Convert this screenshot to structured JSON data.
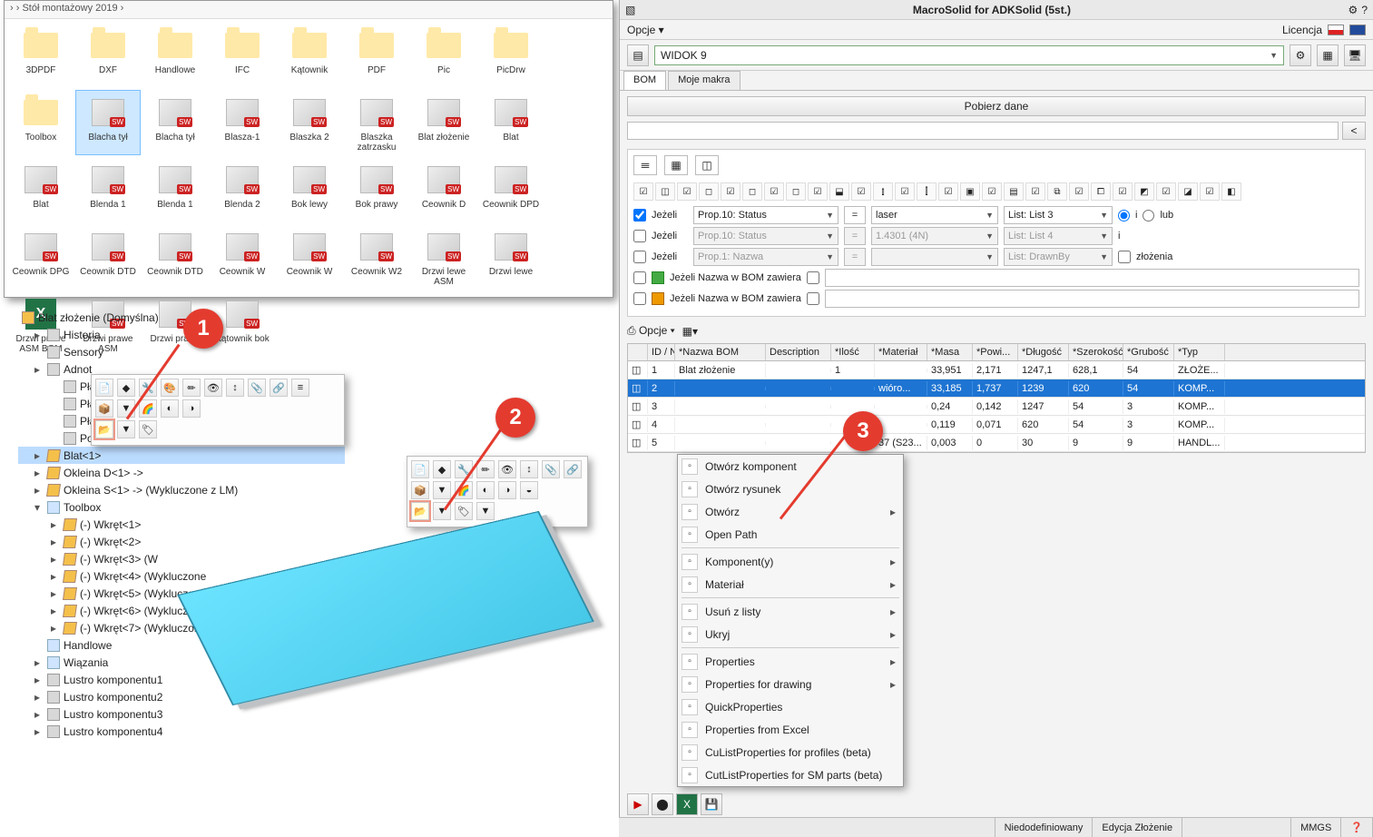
{
  "explorer": {
    "breadcrumb": "›  ›  Stół montażowy 2019  ›",
    "folders": [
      "3DPDF",
      "DXF",
      "Handlowe",
      "IFC",
      "Kątownik",
      "PDF",
      "Pic",
      "PicDrw",
      "Toolbox"
    ],
    "parts_r2": [
      "Blacha tył",
      "Blacha tył",
      "Blasza-1",
      "Blaszka 2",
      "Blaszka zatrzasku",
      "Blat złożenie",
      "Blat",
      "Blat",
      "Blenda 1"
    ],
    "parts_r3": [
      "Blenda 1",
      "Blenda 2",
      "Bok lewy",
      "Bok prawy",
      "Ceownik D",
      "Ceownik DPD",
      "Ceownik DPG",
      "Ceownik DTD",
      "Ceownik DTD"
    ],
    "parts_r4": [
      "Ceownik W",
      "Ceownik W",
      "Ceownik W2",
      "Drzwi lewe ASM",
      "Drzwi lewe",
      "Drzwi prawe ASM BOM",
      "Drzwi prawe ASM",
      "Drzwi prawe",
      "Kątownik bok"
    ],
    "selected": "Blacha tył"
  },
  "tree": {
    "root": "Blat złożenie  (Domyślna)",
    "items": [
      {
        "lvl": 1,
        "tri": "▸",
        "ico": "feat",
        "label": "Historia"
      },
      {
        "lvl": 1,
        "tri": "",
        "ico": "feat",
        "label": "Sensory"
      },
      {
        "lvl": 1,
        "tri": "▸",
        "ico": "feat",
        "label": "Adnot"
      },
      {
        "lvl": 2,
        "tri": "",
        "ico": "feat",
        "label": "Płaszc"
      },
      {
        "lvl": 2,
        "tri": "",
        "ico": "feat",
        "label": "Płaszc"
      },
      {
        "lvl": 2,
        "tri": "",
        "ico": "feat",
        "label": "Płaszc"
      },
      {
        "lvl": 2,
        "tri": "",
        "ico": "feat",
        "label": "Począ"
      },
      {
        "lvl": 1,
        "tri": "▸",
        "ico": "part",
        "label": "Blat<1>",
        "sel": true
      },
      {
        "lvl": 1,
        "tri": "▸",
        "ico": "part",
        "label": "Okleina D<1> ->"
      },
      {
        "lvl": 1,
        "tri": "▸",
        "ico": "part",
        "label": "Okleina S<1> -> (Wykluczone z LM)"
      },
      {
        "lvl": 1,
        "tri": "▾",
        "ico": "folder",
        "label": "Toolbox"
      },
      {
        "lvl": 2,
        "tri": "▸",
        "ico": "part",
        "label": "(-) Wkręt<1>"
      },
      {
        "lvl": 2,
        "tri": "▸",
        "ico": "part",
        "label": "(-) Wkręt<2>"
      },
      {
        "lvl": 2,
        "tri": "▸",
        "ico": "part",
        "label": "(-) Wkręt<3> (W"
      },
      {
        "lvl": 2,
        "tri": "▸",
        "ico": "part",
        "label": "(-) Wkręt<4> (Wykluczone"
      },
      {
        "lvl": 2,
        "tri": "▸",
        "ico": "part",
        "label": "(-) Wkręt<5> (Wykluczone z LM"
      },
      {
        "lvl": 2,
        "tri": "▸",
        "ico": "part",
        "label": "(-) Wkręt<6> (Wykluczone z LM)"
      },
      {
        "lvl": 2,
        "tri": "▸",
        "ico": "part",
        "label": "(-) Wkręt<7> (Wykluczone z LM)"
      },
      {
        "lvl": 1,
        "tri": "",
        "ico": "folder",
        "label": "Handlowe"
      },
      {
        "lvl": 1,
        "tri": "▸",
        "ico": "folder",
        "label": "Wiązania"
      },
      {
        "lvl": 1,
        "tri": "▸",
        "ico": "feat",
        "label": "Lustro komponentu1"
      },
      {
        "lvl": 1,
        "tri": "▸",
        "ico": "feat",
        "label": "Lustro komponentu2"
      },
      {
        "lvl": 1,
        "tri": "▸",
        "ico": "feat",
        "label": "Lustro komponentu3"
      },
      {
        "lvl": 1,
        "tri": "▸",
        "ico": "feat",
        "label": "Lustro komponentu4"
      }
    ]
  },
  "badges": {
    "b1": "1",
    "b2": "2",
    "b3": "3"
  },
  "macrosolid": {
    "title": "MacroSolid for ADKSolid (5st.)",
    "menu_opcje": "Opcje ▾",
    "licencja": "Licencja",
    "view_combo": "WIDOK 9",
    "tabs": {
      "bom": "BOM",
      "moje": "Moje makra"
    },
    "btn_pobierz": "Pobierz dane",
    "search_btn": "<",
    "filters": {
      "jezeli": "Jeżeli",
      "prop_status": "Prop.10: Status",
      "prop_nazwa": "Prop.1: Nazwa",
      "eq": "=",
      "laser": "laser",
      "v_14301": "1.4301 (4N)",
      "list3": "List: List 3",
      "list4": "List: List 4",
      "drawnby": "List: DrawnBy",
      "radio_i": "i",
      "radio_lub": "lub",
      "zlozenia": "złożenia",
      "nazwa_bom": "Jeżeli Nazwa w BOM zawiera"
    },
    "opt_opcje": "Opcje ▾",
    "table": {
      "headers": {
        "id": "ID / Nu..",
        "nazwa": "*Nazwa BOM",
        "desc": "Description",
        "ilosc": "*Ilość",
        "mat": "*Materiał",
        "masa": "*Masa",
        "pow": "*Powi...",
        "dl": "*Długość",
        "sz": "*Szerokość",
        "gr": "*Grubość",
        "typ": "*Typ"
      },
      "rows": [
        {
          "id": "1",
          "nazwa": "Blat złożenie",
          "desc": "",
          "ilosc": "1",
          "mat": "",
          "masa": "33,951",
          "pow": "2,171",
          "dl": "1247,1",
          "sz": "628,1",
          "gr": "54",
          "typ": "ZŁOŻE..."
        },
        {
          "id": "2",
          "nazwa": "",
          "desc": "",
          "ilosc": "",
          "mat": "wióro...",
          "masa": "33,185",
          "pow": "1,737",
          "dl": "1239",
          "sz": "620",
          "gr": "54",
          "typ": "KOMP...",
          "sel": true
        },
        {
          "id": "3",
          "nazwa": "",
          "desc": "",
          "ilosc": "",
          "mat": "",
          "masa": "0,24",
          "pow": "0,142",
          "dl": "1247",
          "sz": "54",
          "gr": "3",
          "typ": "KOMP..."
        },
        {
          "id": "4",
          "nazwa": "",
          "desc": "",
          "ilosc": "",
          "mat": "",
          "masa": "0,119",
          "pow": "0,071",
          "dl": "620",
          "sz": "54",
          "gr": "3",
          "typ": "KOMP..."
        },
        {
          "id": "5",
          "nazwa": "",
          "desc": "",
          "ilosc": "",
          "mat": "37 (S23...",
          "masa": "0,003",
          "pow": "0",
          "dl": "30",
          "sz": "9",
          "gr": "9",
          "typ": "HANDL..."
        }
      ]
    }
  },
  "ctx": {
    "items": [
      {
        "label": "Otwórz komponent"
      },
      {
        "label": "Otwórz rysunek"
      },
      {
        "label": "Otwórz",
        "sub": true
      },
      {
        "label": "Open Path"
      },
      {
        "sep": true
      },
      {
        "label": "Komponent(y)",
        "sub": true
      },
      {
        "label": "Materiał",
        "sub": true
      },
      {
        "sep": true
      },
      {
        "label": "Usuń z listy",
        "sub": true
      },
      {
        "label": "Ukryj",
        "sub": true
      },
      {
        "sep": true
      },
      {
        "label": "Properties",
        "sub": true
      },
      {
        "label": "Properties for drawing",
        "sub": true
      },
      {
        "label": "QuickProperties"
      },
      {
        "label": "Properties from Excel"
      },
      {
        "label": "CuListProperties for profiles (beta)"
      },
      {
        "label": "CutListProperties for SM parts (beta)"
      }
    ]
  },
  "status": {
    "s1": "Niedodefiniowany",
    "s2": "Edycja Złożenie",
    "s3": "MMGS"
  }
}
